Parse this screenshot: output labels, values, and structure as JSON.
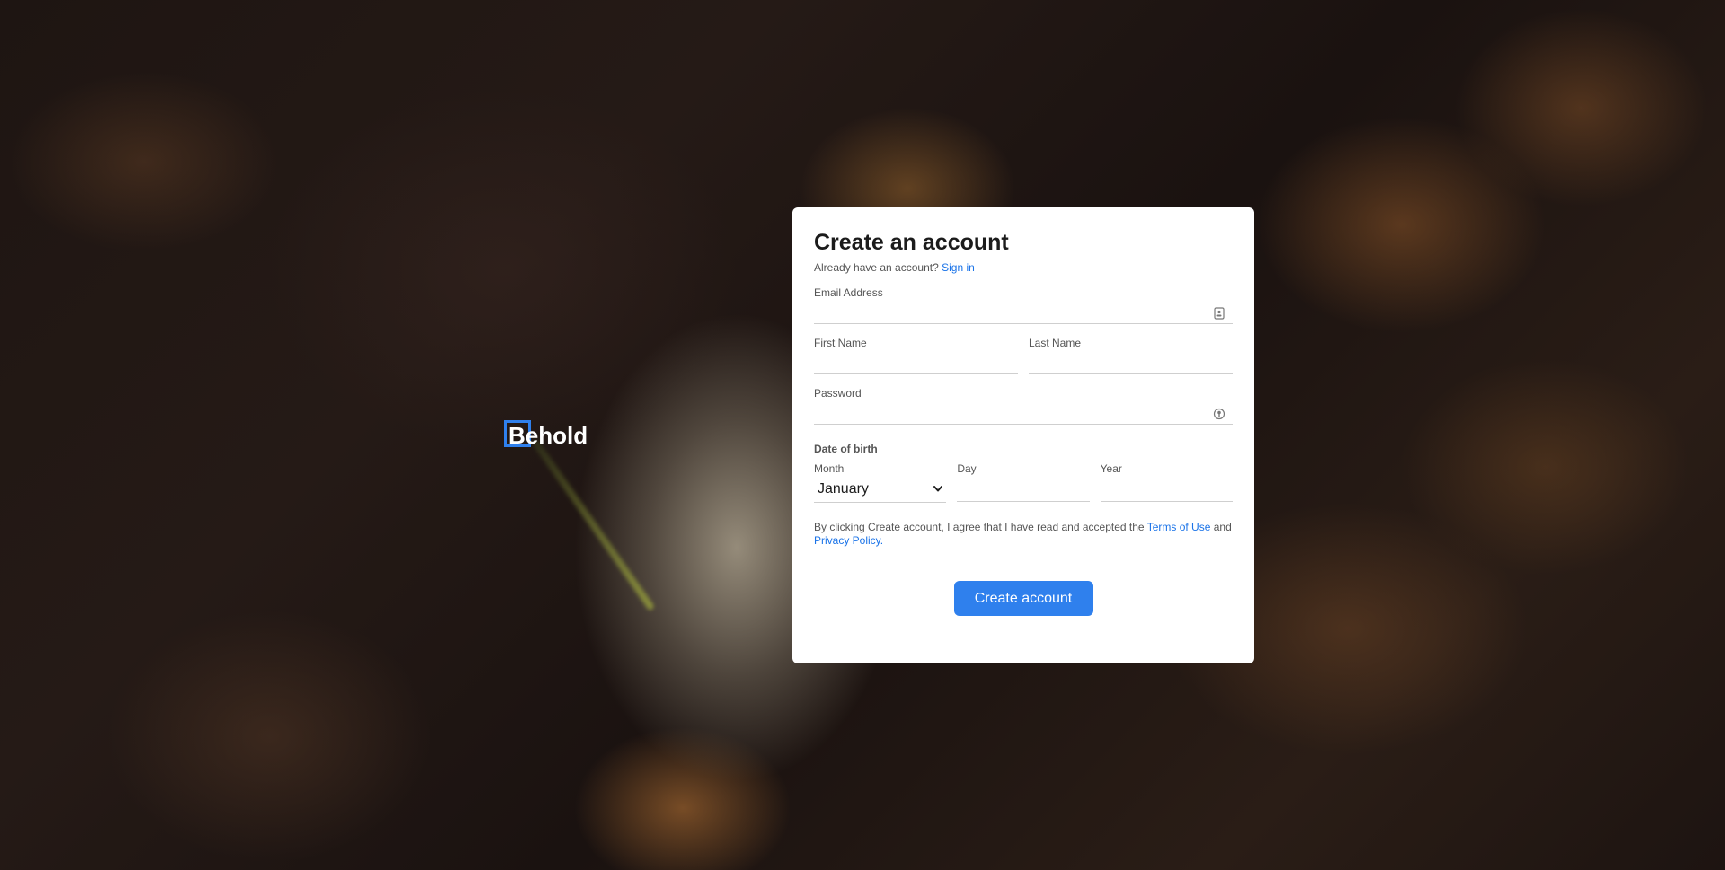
{
  "brand": {
    "name": "Behold"
  },
  "form": {
    "title": "Create an account",
    "signin_prompt": "Already have an account?",
    "signin_link": "Sign in",
    "email_label": "Email Address",
    "email_value": "",
    "first_name_label": "First Name",
    "first_name_value": "",
    "last_name_label": "Last Name",
    "last_name_value": "",
    "password_label": "Password",
    "password_value": "",
    "dob_heading": "Date of birth",
    "month_label": "Month",
    "month_value": "January",
    "day_label": "Day",
    "day_value": "",
    "year_label": "Year",
    "year_value": "",
    "terms_prefix": "By clicking Create account, I agree that I have read and accepted the",
    "terms_link": "Terms of Use",
    "terms_and": "and",
    "privacy_link": "Privacy Policy",
    "terms_suffix": ".",
    "submit_label": "Create account"
  },
  "icons": {
    "email_field_icon": "contact-card-icon",
    "password_field_icon": "key-icon",
    "month_select_icon": "chevron-down-icon"
  },
  "colors": {
    "accent": "#2f80ed",
    "link": "#1a73e8",
    "card": "#ffffff"
  }
}
